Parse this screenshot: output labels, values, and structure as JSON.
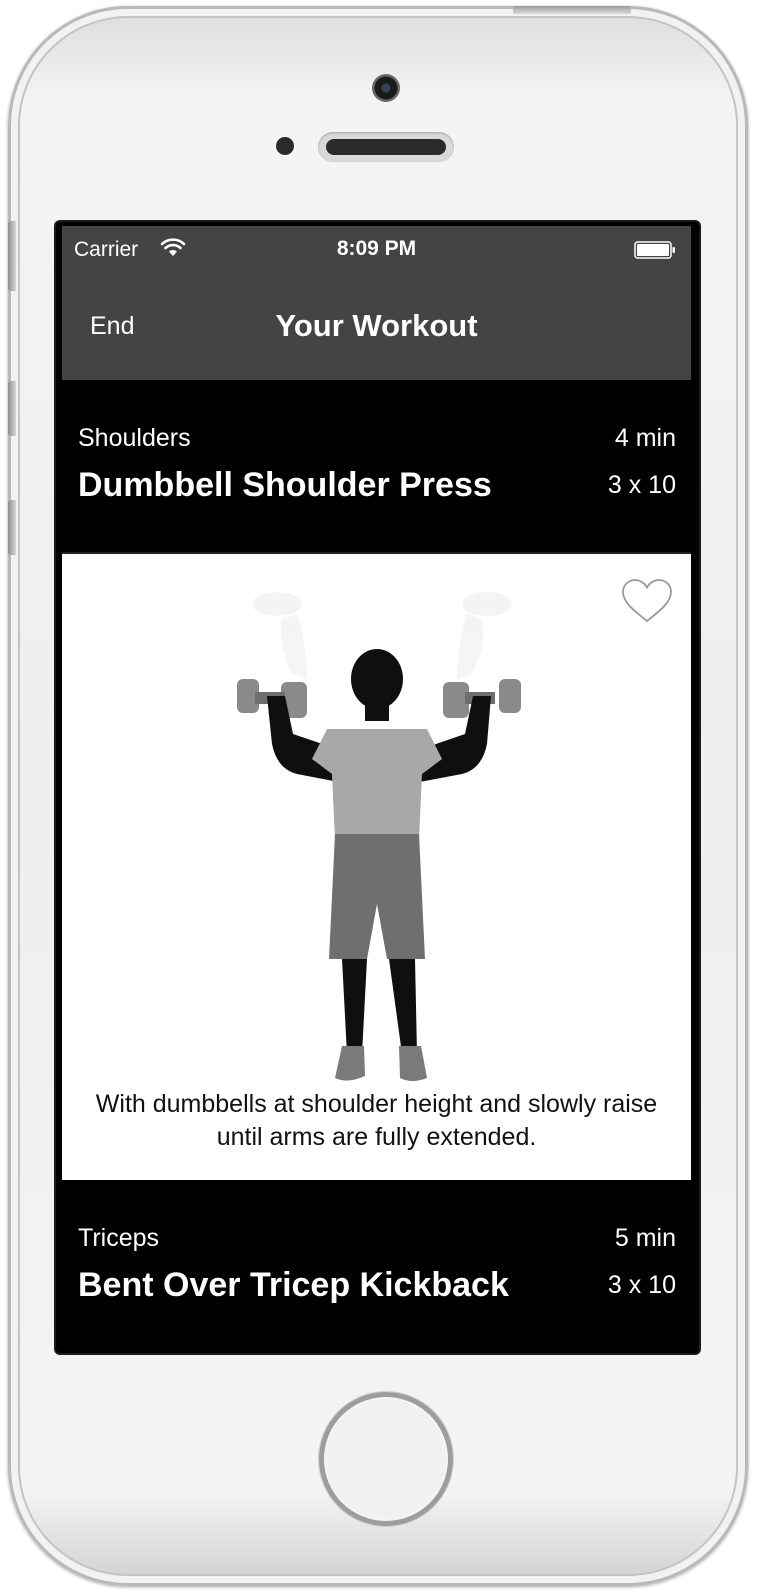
{
  "status_bar": {
    "carrier": "Carrier",
    "time": "8:09 PM"
  },
  "nav": {
    "left_button": "End",
    "title": "Your Workout"
  },
  "exercises": [
    {
      "category": "Shoulders",
      "name": "Dumbbell Shoulder Press",
      "duration": "4 min",
      "sets": "3 x 10",
      "description": "With dumbbells at shoulder height and slowly raise until arms are fully extended.",
      "favorite": false
    },
    {
      "category": "Triceps",
      "name": "Bent Over Tricep Kickback",
      "duration": "5 min",
      "sets": "3 x 10"
    }
  ],
  "icons": {
    "wifi": "wifi-icon",
    "battery": "battery-icon",
    "favorite": "heart-outline-icon"
  },
  "colors": {
    "nav_bar": "#444444",
    "cell_bg": "#000000",
    "detail_bg": "#ffffff"
  }
}
